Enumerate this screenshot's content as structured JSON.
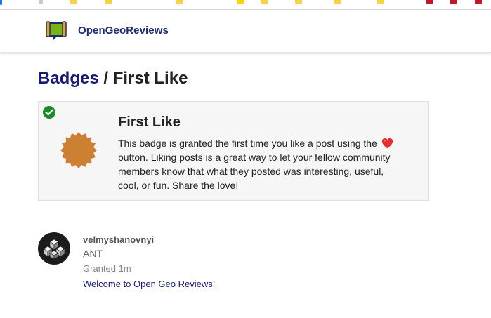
{
  "site": {
    "name": "OpenGeoReviews"
  },
  "breadcrumb": {
    "parent": "Badges",
    "separator": "/",
    "current": "First Like"
  },
  "badge": {
    "name": "First Like",
    "description_part1": "This badge is granted the first time you like a post using the",
    "description_part2": "button. Liking posts is a great way to let your fellow community members know that what they posted was interesting, useful, cool, or fun. Share the love!",
    "inline_icon": "heart-icon",
    "status_icon": "check-circle-icon",
    "badge_icon": "bronze-badge-icon",
    "badge_color": "#cd7f32",
    "check_color": "#1e8a2e"
  },
  "grant": {
    "username": "velmyshanovnyi",
    "title": "ANT",
    "granted_label": "Granted 1m",
    "post_link": "Welcome to Open Geo Reviews!",
    "avatar_icon": "cube-avatar-icon"
  },
  "colors": {
    "brand": "#1f2d6b",
    "link": "#1a1a6e",
    "logo_green": "#7ab317",
    "logo_gold": "#e7a41c"
  }
}
